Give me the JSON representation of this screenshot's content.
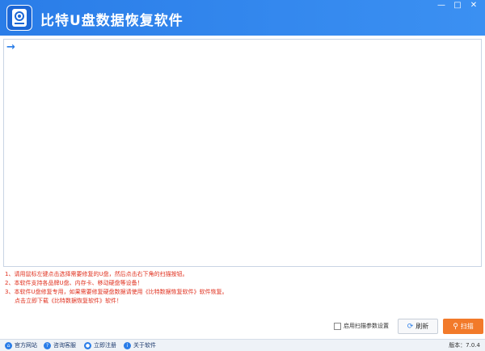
{
  "app": {
    "title": "比特U盘数据恢复软件"
  },
  "window_controls": {
    "minimize": "—",
    "maximize": "□",
    "close": "✕"
  },
  "main": {
    "arrow": "→"
  },
  "notes": [
    "1、请用鼠标左键点击选择需要修复的U盘，然后点击右下角的扫描按钮。",
    "2、本软件支持各品牌U盘、内存卡、移动硬盘等设备！",
    "3、本软件U盘修复专用，如果需要修复硬盘数据请使用《比特数据恢复软件》软件恢复。",
    "点击立即下载《比特数据恢复软件》软件！"
  ],
  "actions": {
    "checkbox_label": "启用扫描参数设置",
    "refresh_label": "刷新",
    "scan_label": "扫描"
  },
  "statusbar": {
    "links": [
      "官方网站",
      "咨询客服",
      "立即注册",
      "关于软件"
    ],
    "version": "版本：7.0.4"
  },
  "icons": {
    "arrow": "arrow-right-icon",
    "refresh": "refresh-icon",
    "scan": "search-icon"
  },
  "colors": {
    "accent": "#2a7de8",
    "scan_button": "#f27a2a",
    "notes": "#e0301e"
  }
}
